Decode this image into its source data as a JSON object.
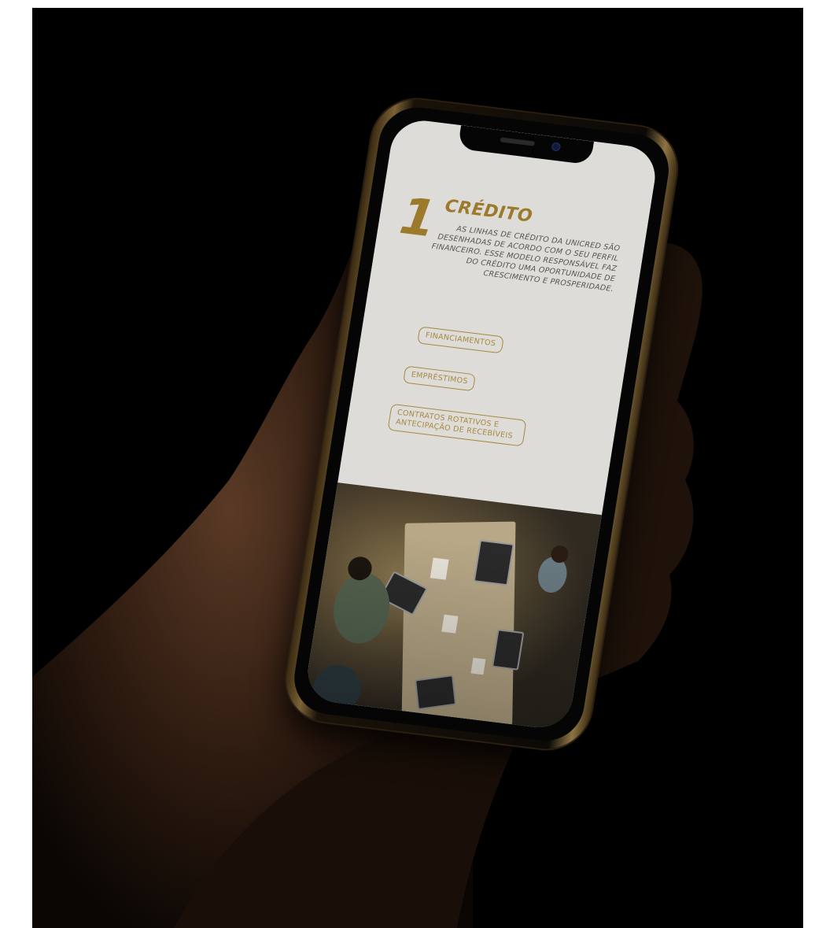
{
  "scene": {
    "background_color": "#000000"
  },
  "screen": {
    "section": {
      "number": "1",
      "title": "CRÉDITO",
      "body": "AS LINHAS DE CRÉDITO DA UNICRED SÃO DESENHADAS DE ACORDO COM O SEU PERFIL FINANCEIRO. ESSE MODELO RESPONSÁVEL FAZ DO CRÉDITO UMA OPORTUNIDADE DE CRESCIMENTO E PROSPERIDADE."
    },
    "buttons": [
      {
        "label": "FINANCIAMENTOS"
      },
      {
        "label": "EMPRÉSTIMOS"
      },
      {
        "label": "CONTRATOS ROTATIVOS E ANTECIPAÇÃO DE RECEBÍVEIS"
      }
    ],
    "accent_color": "#9c7a2c"
  }
}
